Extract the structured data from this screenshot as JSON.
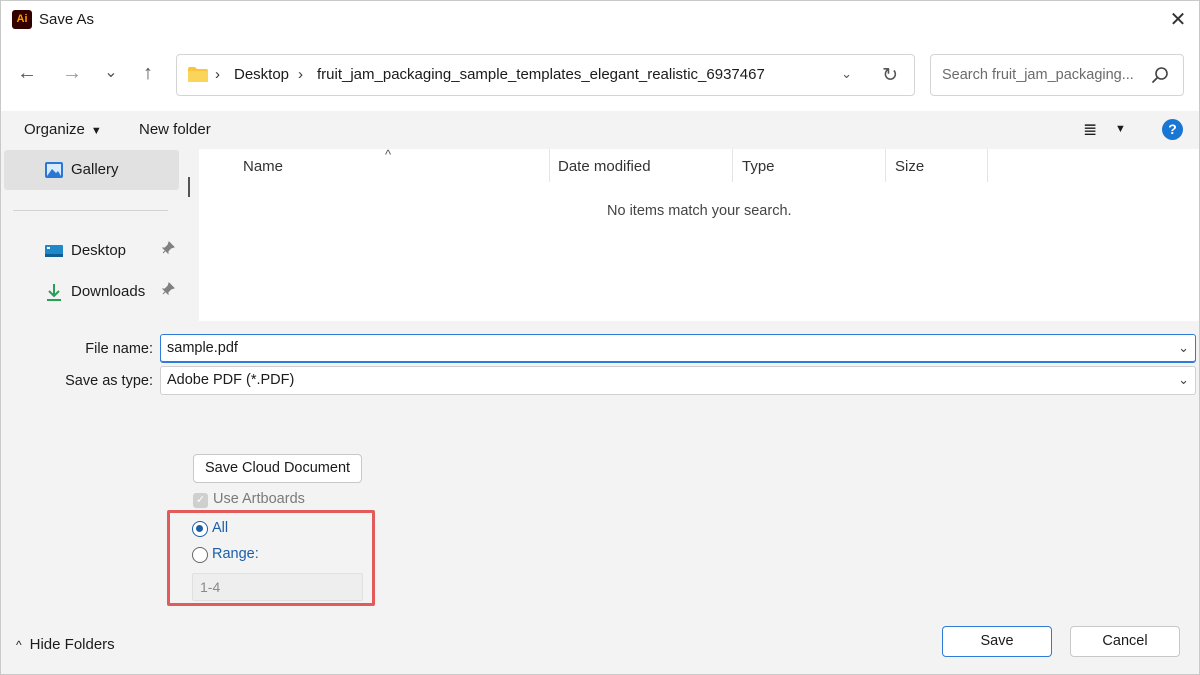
{
  "window": {
    "app_icon_text": "Ai",
    "title": "Save As",
    "close_glyph": "✕"
  },
  "nav": {
    "back_glyph": "←",
    "forward_glyph": "→",
    "recent_glyph": "⌄",
    "up_glyph": "↑",
    "breadcrumb": [
      "Desktop",
      "fruit_jam_packaging_sample_templates_elegant_realistic_6937467"
    ],
    "separator_glyph": "›",
    "dropdown_glyph": "⌄",
    "refresh_glyph": "↻",
    "search_placeholder": "Search fruit_jam_packaging..."
  },
  "toolbar": {
    "organize_label": "Organize",
    "new_folder_label": "New folder",
    "caret_glyph": "▼",
    "view_glyph": "≣",
    "help_glyph": "?"
  },
  "sidebar": {
    "items": [
      {
        "label": "Gallery",
        "icon": "gallery-icon",
        "selected": true
      },
      {
        "label": "Desktop",
        "icon": "desktop-icon",
        "pinned": true
      },
      {
        "label": "Downloads",
        "icon": "downloads-icon",
        "pinned": true
      }
    ],
    "pin_glyph": "📌"
  },
  "filelist": {
    "columns": [
      "Name",
      "Date modified",
      "Type",
      "Size"
    ],
    "sort_glyph": "^",
    "empty_message": "No items match your search."
  },
  "form": {
    "file_name_label": "File name:",
    "file_name_value": "sample.pdf",
    "save_type_label": "Save as type:",
    "save_type_value": "Adobe PDF (*.PDF)",
    "dropdown_glyph": "⌄",
    "cloud_button_label": "Save Cloud Document",
    "use_artboards_label": "Use Artboards",
    "use_artboards_checked": true,
    "radio_all_label": "All",
    "radio_range_label": "Range:",
    "range_value": "1-4",
    "selected_option": "All"
  },
  "footer": {
    "hide_folders_label": "Hide Folders",
    "hide_folders_glyph": "^",
    "save_label": "Save",
    "cancel_label": "Cancel"
  },
  "colors": {
    "accent": "#1c5fa8",
    "highlight": "#e15b5b",
    "app_icon_bg": "#330000",
    "app_icon_fg": "#ff9a00"
  }
}
